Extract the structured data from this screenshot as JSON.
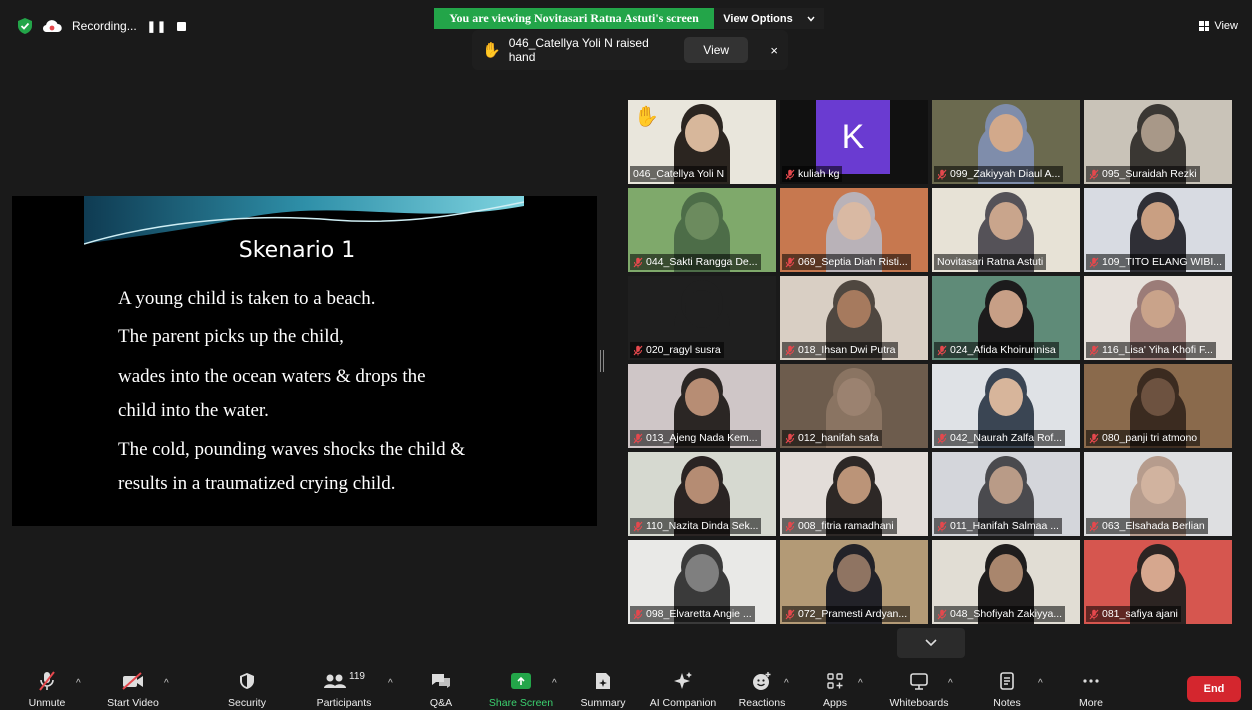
{
  "top": {
    "recording_label": "Recording...",
    "banner_text": "You are viewing Novitasari Ratna Astuti's screen",
    "view_options_label": "View Options",
    "raise_hand_text": "046_Catellya Yoli N raised hand",
    "toast_view_label": "View",
    "toast_close": "×",
    "view_label": "View"
  },
  "slide": {
    "title": "Skenario 1",
    "lines": [
      "A young child is taken to a beach.",
      "The parent picks up the child,",
      "wades into the ocean waters & drops the",
      "child into the water.",
      "The cold, pounding waves shocks the child  &",
      "results in a traumatized crying child."
    ]
  },
  "gallery": {
    "tiles": [
      {
        "name": "046_Catellya Yoli N",
        "muted": false,
        "hand": true,
        "bg": "#e9e6dc",
        "skin": "#2b2520",
        "face": "#d7b79b"
      },
      {
        "name": "kuliah kg",
        "muted": true,
        "avatar": "K",
        "bg": "#111111"
      },
      {
        "name": "099_Zakiyyah Diaul A...",
        "muted": true,
        "bg": "#6b6a4f",
        "skin": "#7f8dab",
        "face": "#d2a98b"
      },
      {
        "name": "095_Suraidah Rezki",
        "muted": true,
        "bg": "#c9c3b8",
        "skin": "#3a3733",
        "face": "#a89888"
      },
      {
        "name": "044_Sakti Rangga De...",
        "muted": true,
        "bg": "#7fa96b",
        "skin": "#4d6d48",
        "face": "#6c8b5e"
      },
      {
        "name": "069_Septia Diah Risti...",
        "muted": true,
        "bg": "#c7784f",
        "skin": "#b9b2b8",
        "face": "#d9b9a3"
      },
      {
        "name": "Novitasari Ratna Astuti",
        "muted": false,
        "active": true,
        "bg": "#e7e2d6",
        "skin": "#555258",
        "face": "#c9a58c"
      },
      {
        "name": "109_TITO ELANG WIBI...",
        "muted": true,
        "bg": "#d8dbe2",
        "skin": "#2f2f36",
        "face": "#c99f82"
      },
      {
        "name": "020_ragyl susra",
        "muted": true,
        "bg": "#1f1f1f",
        "skin": "#1f1f1f",
        "face": "#1f1f1f"
      },
      {
        "name": "018_Ihsan Dwi Putra",
        "muted": true,
        "bg": "#d9cfc4",
        "skin": "#4f4740",
        "face": "#a67a5e"
      },
      {
        "name": "024_Afida Khoirunnisa",
        "muted": true,
        "bg": "#5f8b78",
        "skin": "#1c1b1c",
        "face": "#c79f86"
      },
      {
        "name": "116_Lisa' Yiha Khofi F...",
        "muted": true,
        "bg": "#e6e0da",
        "skin": "#9b7c78",
        "face": "#c9a38a"
      },
      {
        "name": "013_Ajeng Nada Kem...",
        "muted": true,
        "bg": "#cfc6c7",
        "skin": "#2b2624",
        "face": "#b78d74"
      },
      {
        "name": "012_hanifah safa",
        "muted": true,
        "bg": "#6d5c4d",
        "skin": "#8a7462",
        "face": "#9b8270"
      },
      {
        "name": "042_Naurah Zalfa Rof...",
        "muted": true,
        "bg": "#dfe2e6",
        "skin": "#3a4553",
        "face": "#d7b59b"
      },
      {
        "name": "080_panji tri atmono",
        "muted": true,
        "bg": "#8a6a4c",
        "skin": "#3b2b20",
        "face": "#6d5240"
      },
      {
        "name": "110_Nazita Dinda Sek...",
        "muted": true,
        "bg": "#d6d9d0",
        "skin": "#2a2423",
        "face": "#b58c73"
      },
      {
        "name": "008_fitria ramadhani",
        "muted": true,
        "bg": "#e3ddd9",
        "skin": "#2d2826",
        "face": "#bb9478"
      },
      {
        "name": "011_Hanifah Salmaa ...",
        "muted": true,
        "bg": "#d4d6db",
        "skin": "#4a4a4e",
        "face": "#b99b87"
      },
      {
        "name": "063_Elsahada Berlian",
        "muted": true,
        "bg": "#dedfe1",
        "skin": "#b69c8d",
        "face": "#d1b39f"
      },
      {
        "name": "098_Elvaretta Angie ...",
        "muted": true,
        "bg": "#e9e9e7",
        "skin": "#3a3a3a",
        "face": "#7f7f7f"
      },
      {
        "name": "072_Pramesti Ardyan...",
        "muted": true,
        "bg": "#b39a76",
        "skin": "#222228",
        "face": "#8f7462"
      },
      {
        "name": "048_Shofiyah Zakiyya...",
        "muted": true,
        "bg": "#e1ddd4",
        "skin": "#1f1d1d",
        "face": "#a9866d"
      },
      {
        "name": "081_safiya ajani",
        "muted": true,
        "bg": "#d6564f",
        "skin": "#2c2422",
        "face": "#d6a78e"
      }
    ]
  },
  "toolbar": {
    "unmute": "Unmute",
    "start_video": "Start Video",
    "security": "Security",
    "participants": "Participants",
    "participants_count": "119",
    "qa": "Q&A",
    "share_screen": "Share Screen",
    "summary": "Summary",
    "ai_companion": "AI Companion",
    "reactions": "Reactions",
    "apps": "Apps",
    "whiteboards": "Whiteboards",
    "notes": "Notes",
    "more": "More",
    "end": "End"
  },
  "colors": {
    "banner_green": "#23a549",
    "end_red": "#d4262e",
    "active_speaker_outline": "#d8dc6a",
    "muted_red": "#e5484d"
  }
}
